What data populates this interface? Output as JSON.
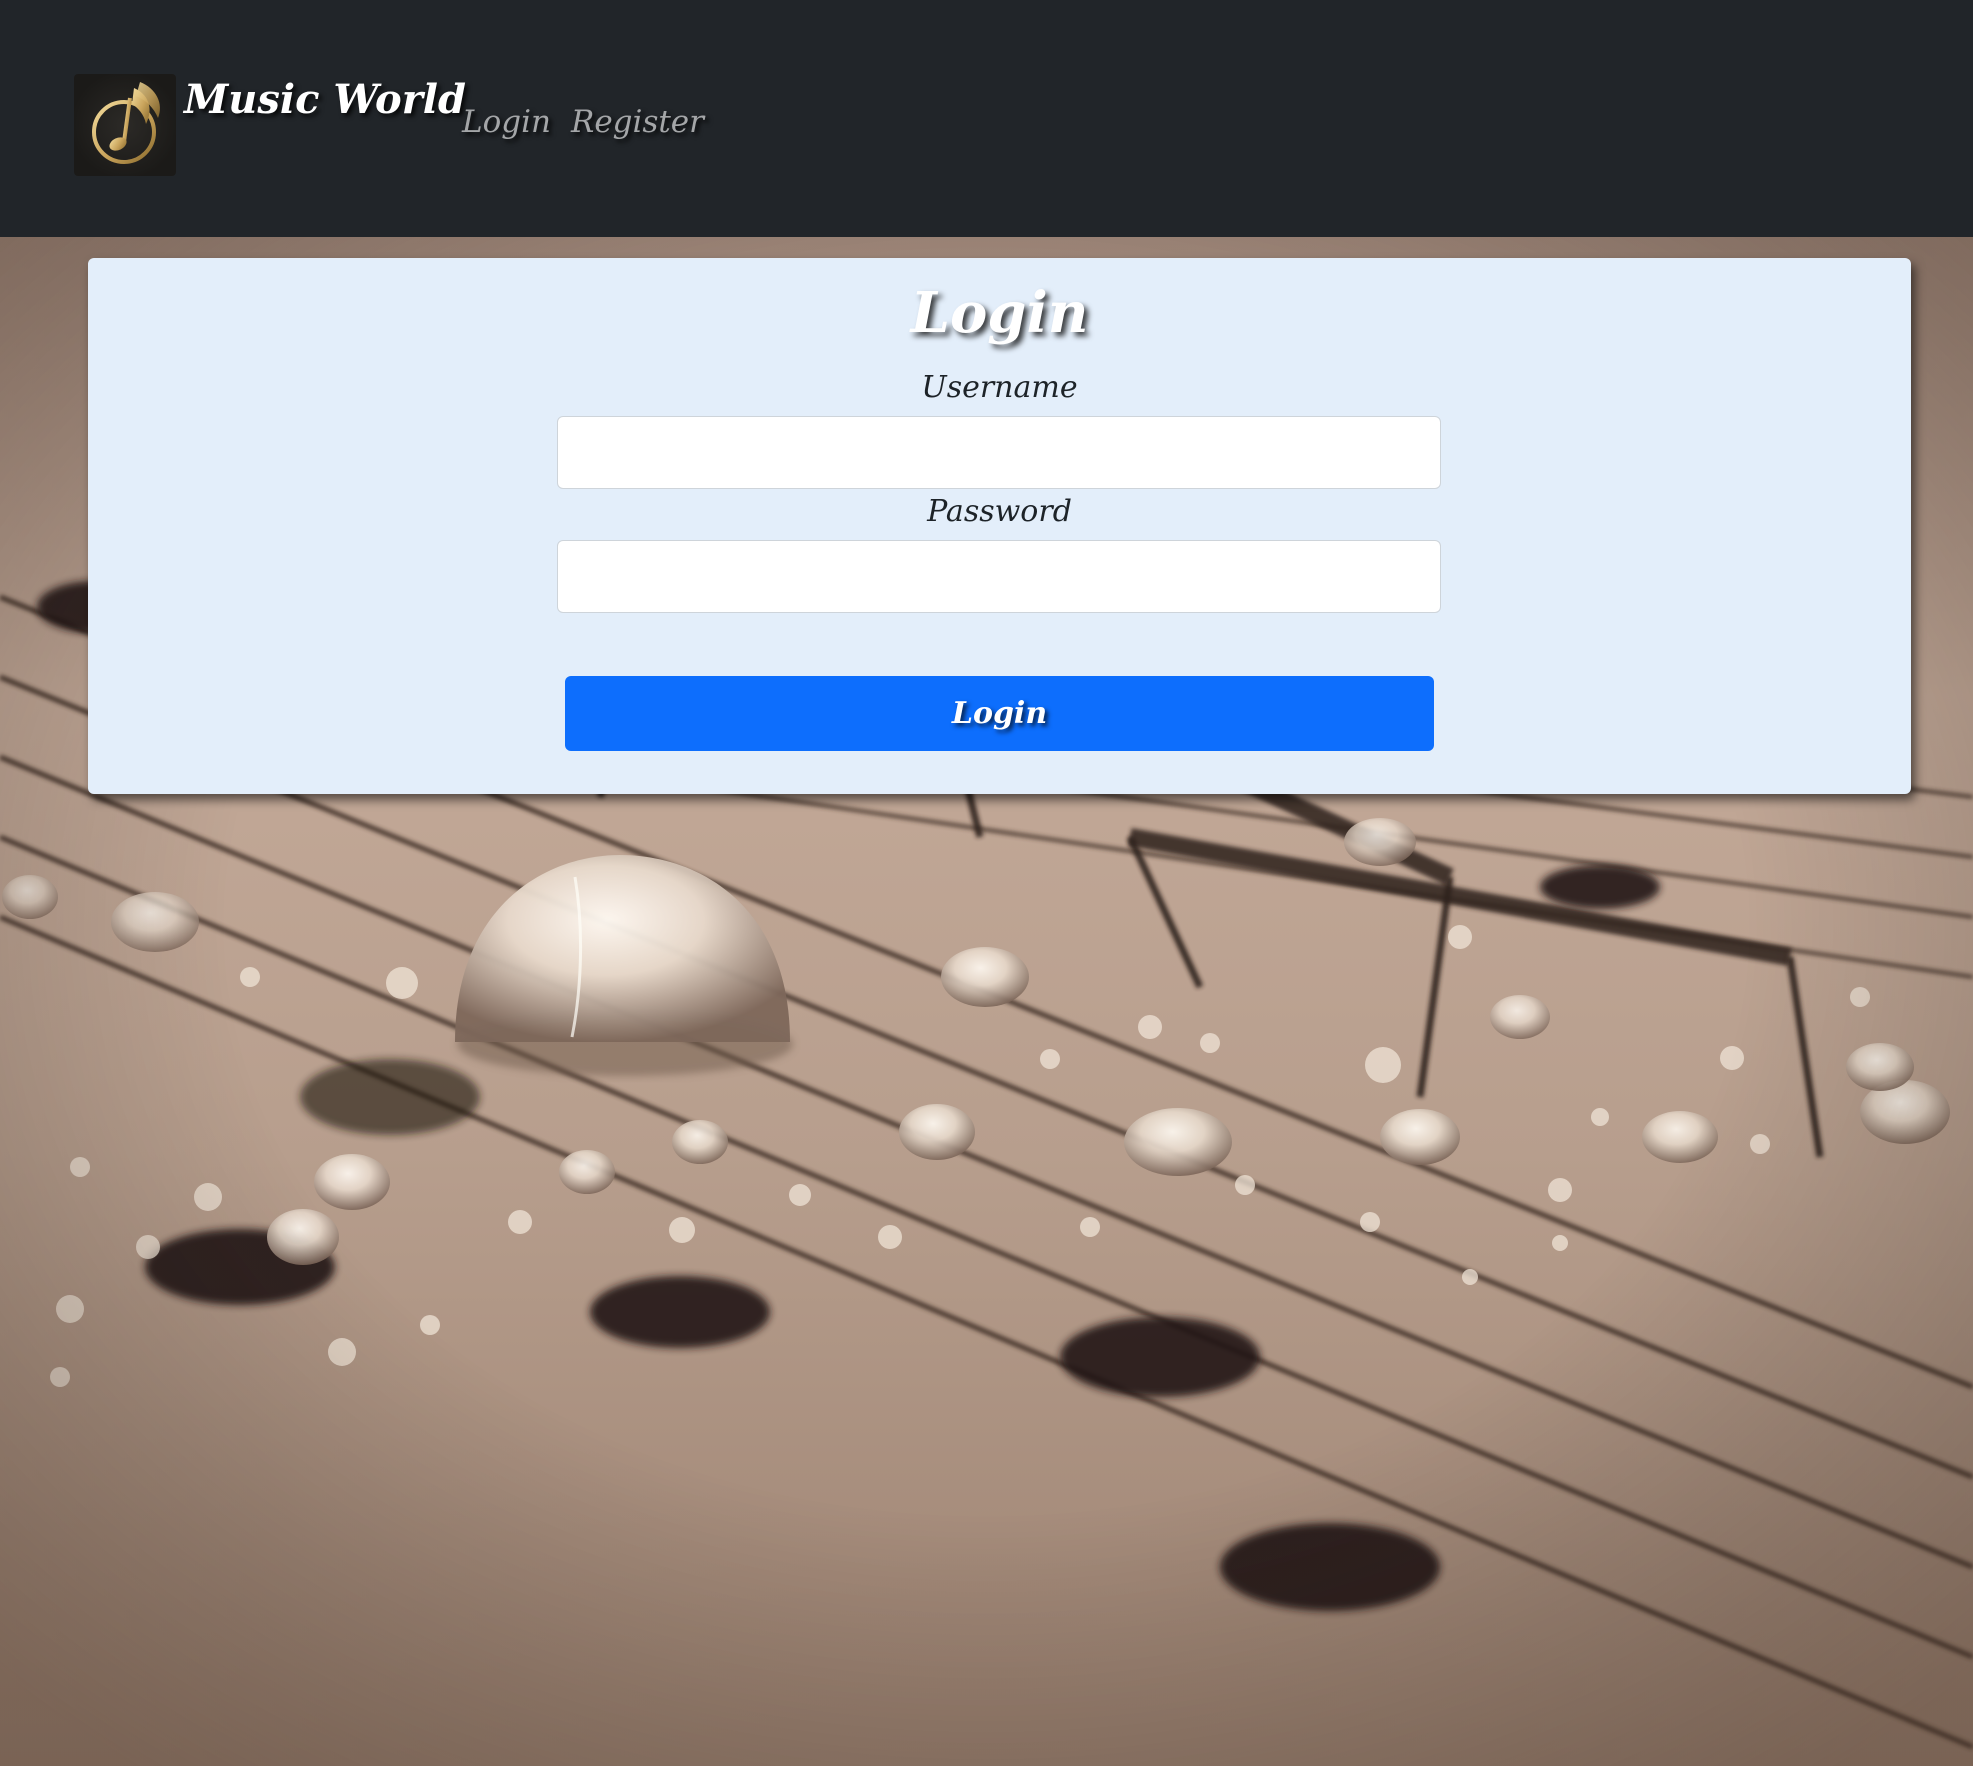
{
  "navbar": {
    "brand": "Music World",
    "logo_icon": "music-note-wing-icon",
    "links": [
      {
        "label": "Login"
      },
      {
        "label": "Register"
      }
    ]
  },
  "login_form": {
    "title": "Login",
    "username_label": "Username",
    "username_value": "",
    "password_label": "Password",
    "password_value": "",
    "submit_label": "Login"
  },
  "background": {
    "image_subject": "sheet-music-with-water-drops",
    "tint": "#b8a192"
  },
  "colors": {
    "navbar": "#212529",
    "card": "#e3eefa",
    "primary_button": "#0d6efd",
    "logo_gold": "#c9a45c"
  }
}
